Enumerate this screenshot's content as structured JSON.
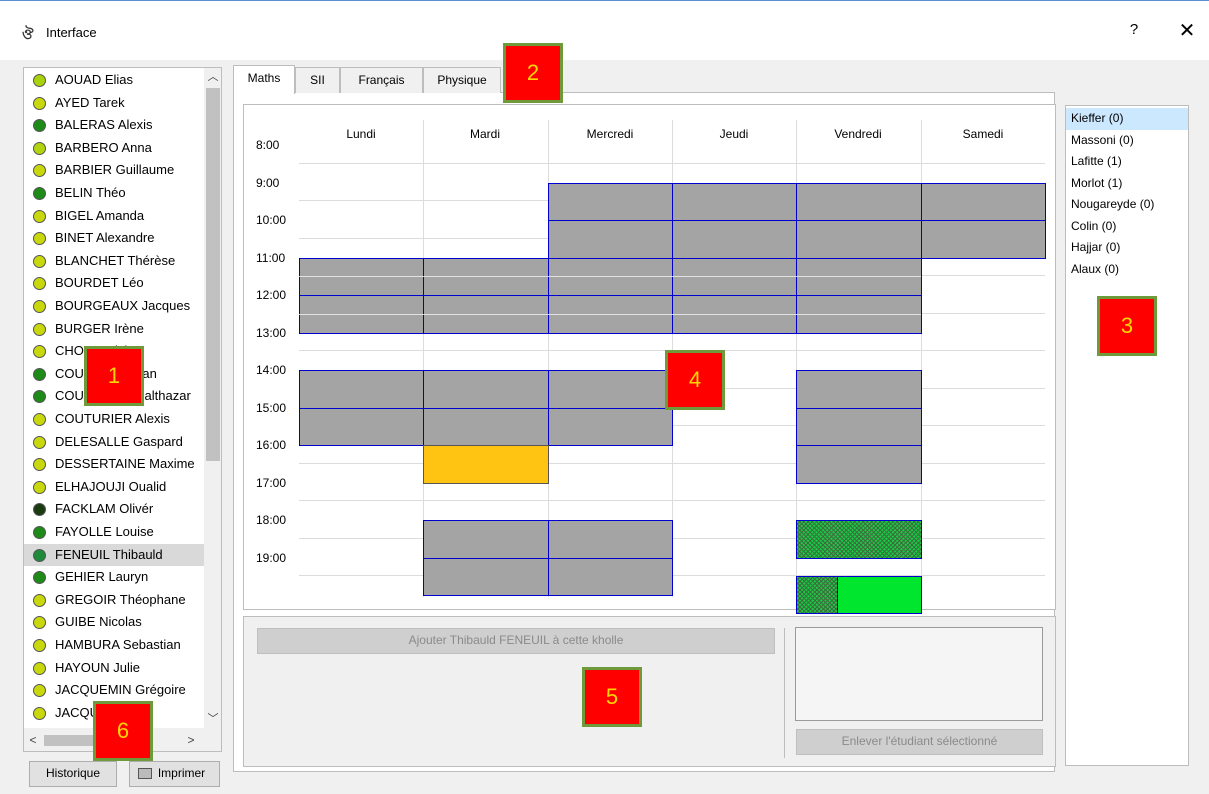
{
  "window": {
    "title": "Interface",
    "icon": "app-icon",
    "help_label": "?",
    "close_label": "✕"
  },
  "tabs": [
    {
      "label": "Maths",
      "active": true
    },
    {
      "label": "SII",
      "active": false
    },
    {
      "label": "Français",
      "active": false
    },
    {
      "label": "Physique",
      "active": false
    }
  ],
  "students": [
    {
      "name": "AOUAD Elias",
      "status_color": "#a8d20b"
    },
    {
      "name": "AYED Tarek",
      "status_color": "#c8d80c"
    },
    {
      "name": "BALERAS Alexis",
      "status_color": "#1e8a18"
    },
    {
      "name": "BARBERO Anna",
      "status_color": "#b2d40e"
    },
    {
      "name": "BARBIER Guillaume",
      "status_color": "#c8d80c"
    },
    {
      "name": "BELIN Théo",
      "status_color": "#1e8a18"
    },
    {
      "name": "BIGEL Amanda",
      "status_color": "#c8d80c"
    },
    {
      "name": "BINET Alexandre",
      "status_color": "#c8d80c"
    },
    {
      "name": "BLANCHET Thérèse",
      "status_color": "#c8d80c"
    },
    {
      "name": "BOURDET Léo",
      "status_color": "#c8d80c"
    },
    {
      "name": "BOURGEAUX Jacques",
      "status_color": "#c8d80c"
    },
    {
      "name": "BURGER Irène",
      "status_color": "#c8d80c"
    },
    {
      "name": "CHOI Patrick",
      "status_color": "#c8d80c"
    },
    {
      "name": "COUTURIER Jan",
      "status_color": "#1e8a18"
    },
    {
      "name": "COUTURIER Balthazar",
      "status_color": "#1e8a18"
    },
    {
      "name": "COUTURIER Alexis",
      "status_color": "#c8d80c"
    },
    {
      "name": "DELESALLE Gaspard",
      "status_color": "#c8d80c"
    },
    {
      "name": "DESSERTAINE Maxime",
      "status_color": "#c8d80c"
    },
    {
      "name": "ELHAJOUJI Oualid",
      "status_color": "#c8d80c"
    },
    {
      "name": "FACKLAM Olivér",
      "status_color": "#1a3a10"
    },
    {
      "name": "FAYOLLE Louise",
      "status_color": "#1e8a18"
    },
    {
      "name": "FENEUIL Thibauld",
      "status_color": "#1e8a3a",
      "selected": true
    },
    {
      "name": "GEHIER Lauryn",
      "status_color": "#1e8a18"
    },
    {
      "name": "GREGOIR Théophane",
      "status_color": "#c8d80c"
    },
    {
      "name": "GUIBE Nicolas",
      "status_color": "#c8d80c"
    },
    {
      "name": "HAMBURA Sebastian",
      "status_color": "#c8d80c"
    },
    {
      "name": "HAYOUN Julie",
      "status_color": "#c8d80c"
    },
    {
      "name": "JACQUEMIN Grégoire",
      "status_color": "#c8d80c"
    },
    {
      "name": "JACQUOT Louis",
      "status_color": "#c8d80c"
    }
  ],
  "days": [
    "Lundi",
    "Mardi",
    "Mercredi",
    "Jeudi",
    "Vendredi",
    "Samedi"
  ],
  "times": [
    "8:00",
    "9:00",
    "10:00",
    "11:00",
    "12:00",
    "13:00",
    "14:00",
    "15:00",
    "16:00",
    "17:00",
    "18:00",
    "19:00"
  ],
  "teachers": [
    {
      "label": "Kieffer (0)",
      "selected": true
    },
    {
      "label": "Massoni (0)"
    },
    {
      "label": "Lafitte (1)"
    },
    {
      "label": "Morlot (1)"
    },
    {
      "label": "Nougareyde (0)"
    },
    {
      "label": "Colin (0)"
    },
    {
      "label": "Hajjar (0)"
    },
    {
      "label": "Alaux (0)"
    }
  ],
  "buttons": {
    "add": "Ajouter Thibauld FENEUIL à cette kholle",
    "remove": "Enlever l'étudiant sélectionné",
    "history": "Historique",
    "print": "Imprimer"
  },
  "markers": [
    "1",
    "2",
    "3",
    "4",
    "5",
    "6"
  ],
  "colors": {
    "occupied": "#a4a4a4",
    "slot_border": "#0000cc",
    "selected_slot": "#ffc412",
    "available": "#00e62e",
    "marker_bg": "#ff0000"
  }
}
